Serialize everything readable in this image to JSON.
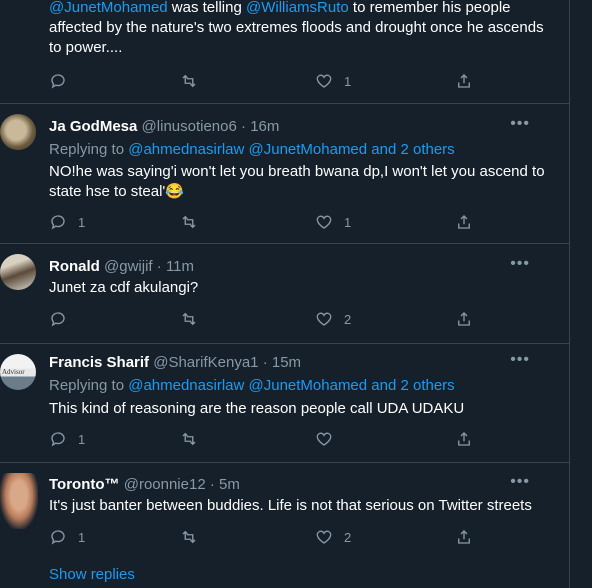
{
  "tweets": [
    {
      "lines": [
        {
          "segments": [
            {
              "text": "@JunetMohamed",
              "link": true
            },
            {
              "text": " was telling ",
              "link": false
            },
            {
              "text": "@WilliamsRuto",
              "link": true
            },
            {
              "text": " to remember his people",
              "link": false
            }
          ]
        },
        {
          "segments": [
            {
              "text": "affected by the nature's two extremes floods and drought once he ascends",
              "link": false
            }
          ]
        },
        {
          "segments": [
            {
              "text": "to power....",
              "link": false
            }
          ]
        }
      ],
      "replies": "",
      "retweets": "",
      "likes": "1"
    },
    {
      "name": "Ja GodMesa",
      "handle": "@linusotieno6",
      "dot": "·",
      "time": "16m",
      "replying_prefix": "Replying to ",
      "replying_links": "@ahmednasirlaw @JunetMohamed and 2 others",
      "text": "NO!he was saying'i won't let you breath bwana dp,I won't let you ascend to state hse to steal'😂",
      "replies": "1",
      "retweets": "",
      "likes": "1"
    },
    {
      "name": "Ronald",
      "handle": "@gwijif",
      "dot": "·",
      "time": "11m",
      "text": "Junet za cdf akulangi?",
      "replies": "",
      "retweets": "",
      "likes": "2"
    },
    {
      "name": "Francis Sharif",
      "handle": "@SharifKenya1",
      "dot": "·",
      "time": "15m",
      "replying_prefix": "Replying to ",
      "replying_links": "@ahmednasirlaw @JunetMohamed and 2 others",
      "text": "This kind of reasoning are the reason people call UDA UDAKU",
      "avatar_text": "ax Advisor",
      "replies": "1",
      "retweets": "",
      "likes": ""
    },
    {
      "name": "Toronto™",
      "handle": "@roonnie12",
      "dot": "·",
      "time": "5m",
      "text": "It's just banter between buddies. Life is not that serious on Twitter streets",
      "replies": "1",
      "retweets": "",
      "likes": "2"
    }
  ],
  "show_replies": "Show replies",
  "colors": {
    "background": "#15202b",
    "link": "#1d9bf0",
    "muted": "#8899a6",
    "divider": "#38444d"
  },
  "icons": {
    "reply": "reply-icon",
    "retweet": "retweet-icon",
    "like": "heart-icon",
    "share": "share-icon",
    "more": "more-icon"
  }
}
